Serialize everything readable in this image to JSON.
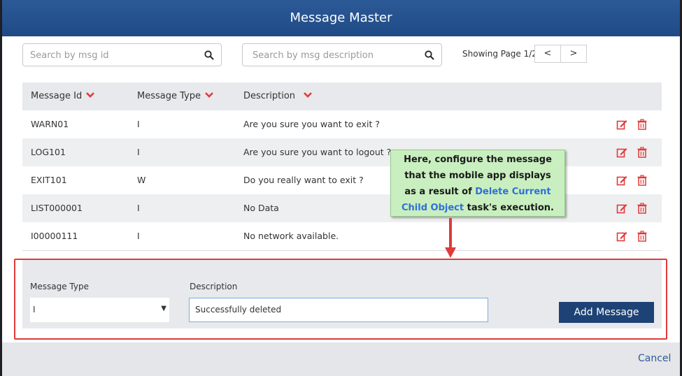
{
  "dialog": {
    "title": "Message Master"
  },
  "search": {
    "msg_id_placeholder": "Search by msg id",
    "msg_description_placeholder": "Search by msg description"
  },
  "pager": {
    "label": "Showing Page 1/2",
    "prev": "<",
    "next": ">"
  },
  "table": {
    "headers": [
      "Message Id",
      "Message Type",
      "Description"
    ],
    "rows": [
      {
        "id": "WARN01",
        "type": "I",
        "description": "Are you sure you want to exit ?"
      },
      {
        "id": "LOG101",
        "type": "I",
        "description": "Are you sure you want to logout ?"
      },
      {
        "id": "EXIT101",
        "type": "W",
        "description": "Do you really want to exit ?"
      },
      {
        "id": "LIST000001",
        "type": "I",
        "description": "No Data"
      },
      {
        "id": "I00000111",
        "type": "I",
        "description": "No network available."
      }
    ]
  },
  "form": {
    "type_label": "Message Type",
    "type_value": "I",
    "description_label": "Description",
    "description_value": "Successfully deleted",
    "add_button": "Add Message"
  },
  "footer": {
    "cancel": "Cancel"
  },
  "callout": {
    "line1": "Here, configure the message",
    "line2": "that the mobile app displays",
    "line3_prefix": "as a result of ",
    "line3_highlight": "Delete Current",
    "line4_highlight": "Child Object",
    "line4_suffix": " task's execution."
  },
  "colors": {
    "header": "#1f4a86",
    "action_icon": "#e03a3a",
    "add_button": "#1d4275",
    "callout_bg": "#c9efc0",
    "callout_highlight": "#2f6fd8",
    "highlight_border": "#e03a3a"
  },
  "icons": {
    "search": "search-icon",
    "sort": "caret-down-icon",
    "edit": "edit-icon",
    "delete": "trash-icon"
  }
}
